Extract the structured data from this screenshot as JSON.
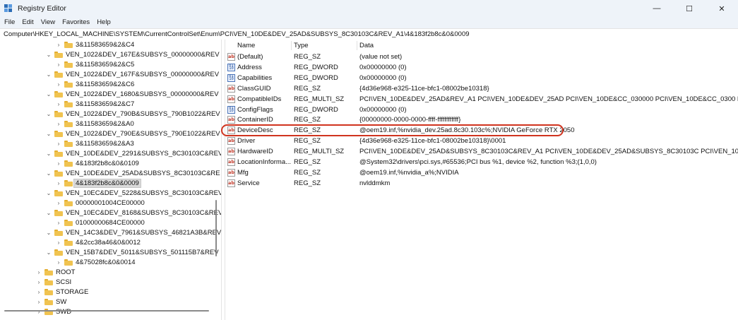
{
  "window": {
    "title": "Registry Editor",
    "minimize_glyph": "—",
    "maximize_glyph": "☐",
    "close_glyph": "✕"
  },
  "menu": [
    "File",
    "Edit",
    "View",
    "Favorites",
    "Help"
  ],
  "address": "Computer\\HKEY_LOCAL_MACHINE\\SYSTEM\\CurrentControlSet\\Enum\\PCI\\VEN_10DE&DEV_25AD&SUBSYS_8C30103C&REV_A1\\4&183f2b8c&0&0009",
  "tree": [
    {
      "label": "3&11583659&2&C4",
      "chevron": "›"
    },
    {
      "label": "VEN_1022&DEV_167E&SUBSYS_00000000&REV",
      "chevron": "⌄"
    },
    {
      "label": "3&11583659&2&C5",
      "chevron": "›"
    },
    {
      "label": "VEN_1022&DEV_167F&SUBSYS_00000000&REV",
      "chevron": "⌄"
    },
    {
      "label": "3&11583659&2&C6",
      "chevron": "›"
    },
    {
      "label": "VEN_1022&DEV_1680&SUBSYS_00000000&REV",
      "chevron": "⌄"
    },
    {
      "label": "3&11583659&2&C7",
      "chevron": "›"
    },
    {
      "label": "VEN_1022&DEV_790B&SUBSYS_790B1022&REV",
      "chevron": "⌄"
    },
    {
      "label": "3&11583659&2&A0",
      "chevron": "›"
    },
    {
      "label": "VEN_1022&DEV_790E&SUBSYS_790E1022&REV",
      "chevron": "⌄"
    },
    {
      "label": "3&11583659&2&A3",
      "chevron": "›"
    },
    {
      "label": "VEN_10DE&DEV_2291&SUBSYS_8C30103C&REV",
      "chevron": "⌄"
    },
    {
      "label": "4&183f2b8c&0&0109",
      "chevron": "›"
    },
    {
      "label": "VEN_10DE&DEV_25AD&SUBSYS_8C30103C&RE",
      "chevron": "⌄"
    },
    {
      "label": "4&183f2b8c&0&0009",
      "chevron": "›"
    },
    {
      "label": "VEN_10EC&DEV_5228&SUBSYS_8C30103C&REV",
      "chevron": "⌄"
    },
    {
      "label": "00000001004CE00000",
      "chevron": "›"
    },
    {
      "label": "VEN_10EC&DEV_8168&SUBSYS_8C30103C&REV",
      "chevron": "⌄"
    },
    {
      "label": "01000000684CE00000",
      "chevron": "›"
    },
    {
      "label": "VEN_14C3&DEV_7961&SUBSYS_46821A3B&REV",
      "chevron": "⌄"
    },
    {
      "label": "4&2cc38a46&0&0012",
      "chevron": "›"
    },
    {
      "label": "VEN_15B7&DEV_5011&SUBSYS_501115B7&REV",
      "chevron": "⌄"
    },
    {
      "label": "4&75028fc&0&0014",
      "chevron": "›"
    },
    {
      "label": "ROOT",
      "chevron": "›"
    },
    {
      "label": "SCSI",
      "chevron": "›"
    },
    {
      "label": "STORAGE",
      "chevron": "›"
    },
    {
      "label": "SW",
      "chevron": "›"
    },
    {
      "label": "SWD",
      "chevron": "›"
    }
  ],
  "columns": {
    "name": "Name",
    "type": "Type",
    "data": "Data"
  },
  "values": [
    {
      "name": "(Default)",
      "type": "REG_SZ",
      "data": "(value not set)",
      "icon": "string-value-icon",
      "glyph": "ab"
    },
    {
      "name": "Address",
      "type": "REG_DWORD",
      "data": "0x00000000 (0)",
      "icon": "binary-value-icon",
      "glyph": "01 10"
    },
    {
      "name": "Capabilities",
      "type": "REG_DWORD",
      "data": "0x00000000 (0)",
      "icon": "binary-value-icon",
      "glyph": "01 10"
    },
    {
      "name": "ClassGUID",
      "type": "REG_SZ",
      "data": "{4d36e968-e325-11ce-bfc1-08002be10318}",
      "icon": "string-value-icon",
      "glyph": "ab"
    },
    {
      "name": "CompatibleIDs",
      "type": "REG_MULTI_SZ",
      "data": "PCI\\VEN_10DE&DEV_25AD&REV_A1 PCI\\VEN_10DE&DEV_25AD PCI\\VEN_10DE&CC_030000 PCI\\VEN_10DE&CC_0300 PCI\\VEN_10",
      "icon": "string-value-icon",
      "glyph": "ab"
    },
    {
      "name": "ConfigFlags",
      "type": "REG_DWORD",
      "data": "0x00000000 (0)",
      "icon": "binary-value-icon",
      "glyph": "01 10"
    },
    {
      "name": "ContainerID",
      "type": "REG_SZ",
      "data": "{00000000-0000-0000-ffff-ffffffffffff}",
      "icon": "string-value-icon",
      "glyph": "ab"
    },
    {
      "name": "DeviceDesc",
      "type": "REG_SZ",
      "data": "@oem19.inf,%nvidia_dev.25ad.8c30.103c%;NVIDIA GeForce RTX 2050",
      "icon": "string-value-icon",
      "glyph": "ab"
    },
    {
      "name": "Driver",
      "type": "REG_SZ",
      "data": "{4d36e968-e325-11ce-bfc1-08002be10318}\\0001",
      "icon": "string-value-icon",
      "glyph": "ab"
    },
    {
      "name": "HardwareID",
      "type": "REG_MULTI_SZ",
      "data": "PCI\\VEN_10DE&DEV_25AD&SUBSYS_8C30103C&REV_A1 PCI\\VEN_10DE&DEV_25AD&SUBSYS_8C30103C PCI\\VEN_10DE&DEV_25A",
      "icon": "string-value-icon",
      "glyph": "ab"
    },
    {
      "name": "LocationInforma...",
      "type": "REG_SZ",
      "data": "@System32\\drivers\\pci.sys,#65536;PCI bus %1, device %2, function %3;(1,0,0)",
      "icon": "string-value-icon",
      "glyph": "ab"
    },
    {
      "name": "Mfg",
      "type": "REG_SZ",
      "data": "@oem19.inf,%nvidia_a%;NVIDIA",
      "icon": "string-value-icon",
      "glyph": "ab"
    },
    {
      "name": "Service",
      "type": "REG_SZ",
      "data": "nvlddmkm",
      "icon": "string-value-icon",
      "glyph": "ab"
    }
  ]
}
